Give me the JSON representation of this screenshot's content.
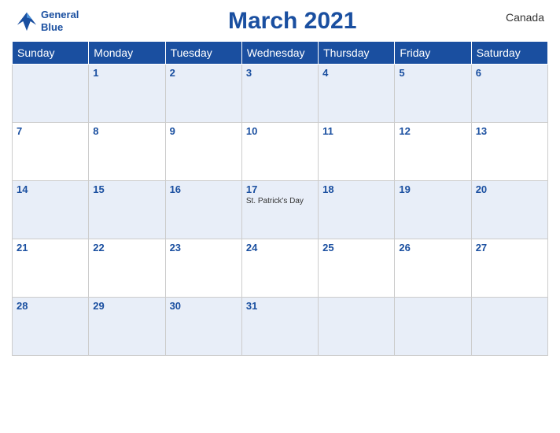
{
  "header": {
    "logo_line1": "General",
    "logo_line2": "Blue",
    "title": "March 2021",
    "country": "Canada"
  },
  "days_of_week": [
    "Sunday",
    "Monday",
    "Tuesday",
    "Wednesday",
    "Thursday",
    "Friday",
    "Saturday"
  ],
  "weeks": [
    [
      {
        "day": "",
        "event": ""
      },
      {
        "day": "1",
        "event": ""
      },
      {
        "day": "2",
        "event": ""
      },
      {
        "day": "3",
        "event": ""
      },
      {
        "day": "4",
        "event": ""
      },
      {
        "day": "5",
        "event": ""
      },
      {
        "day": "6",
        "event": ""
      }
    ],
    [
      {
        "day": "7",
        "event": ""
      },
      {
        "day": "8",
        "event": ""
      },
      {
        "day": "9",
        "event": ""
      },
      {
        "day": "10",
        "event": ""
      },
      {
        "day": "11",
        "event": ""
      },
      {
        "day": "12",
        "event": ""
      },
      {
        "day": "13",
        "event": ""
      }
    ],
    [
      {
        "day": "14",
        "event": ""
      },
      {
        "day": "15",
        "event": ""
      },
      {
        "day": "16",
        "event": ""
      },
      {
        "day": "17",
        "event": "St. Patrick's Day"
      },
      {
        "day": "18",
        "event": ""
      },
      {
        "day": "19",
        "event": ""
      },
      {
        "day": "20",
        "event": ""
      }
    ],
    [
      {
        "day": "21",
        "event": ""
      },
      {
        "day": "22",
        "event": ""
      },
      {
        "day": "23",
        "event": ""
      },
      {
        "day": "24",
        "event": ""
      },
      {
        "day": "25",
        "event": ""
      },
      {
        "day": "26",
        "event": ""
      },
      {
        "day": "27",
        "event": ""
      }
    ],
    [
      {
        "day": "28",
        "event": ""
      },
      {
        "day": "29",
        "event": ""
      },
      {
        "day": "30",
        "event": ""
      },
      {
        "day": "31",
        "event": ""
      },
      {
        "day": "",
        "event": ""
      },
      {
        "day": "",
        "event": ""
      },
      {
        "day": "",
        "event": ""
      }
    ]
  ]
}
